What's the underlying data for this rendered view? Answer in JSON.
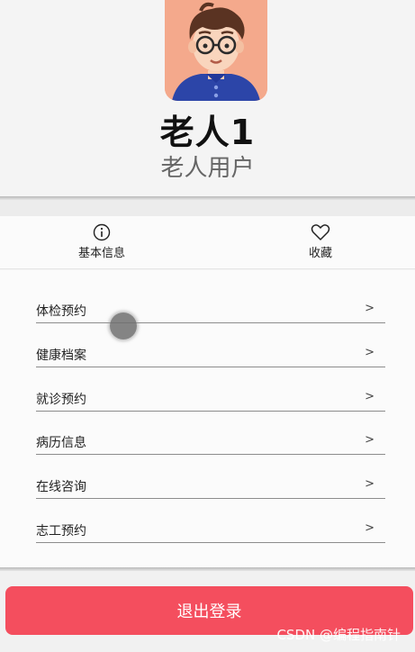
{
  "profile": {
    "name": "老人1",
    "role": "老人用户",
    "avatar_icon": "cartoon-person-with-glasses-avatar"
  },
  "quick_links": [
    {
      "label": "基本信息",
      "icon": "info-circle-icon"
    },
    {
      "label": "收藏",
      "icon": "heart-icon"
    }
  ],
  "menu": {
    "items": [
      {
        "label": "体检预约",
        "arrow": ">"
      },
      {
        "label": "健康档案",
        "arrow": ">"
      },
      {
        "label": "就诊预约",
        "arrow": ">"
      },
      {
        "label": "病历信息",
        "arrow": ">"
      },
      {
        "label": "在线咨询",
        "arrow": ">"
      },
      {
        "label": "志工预约",
        "arrow": ">"
      }
    ]
  },
  "actions": {
    "logout_label": "退出登录"
  },
  "watermark": "CSDN @编程指南针",
  "colors": {
    "accent": "#f44e5e",
    "avatar_bg": "#f4a98c",
    "background": "#f4f4f4"
  }
}
